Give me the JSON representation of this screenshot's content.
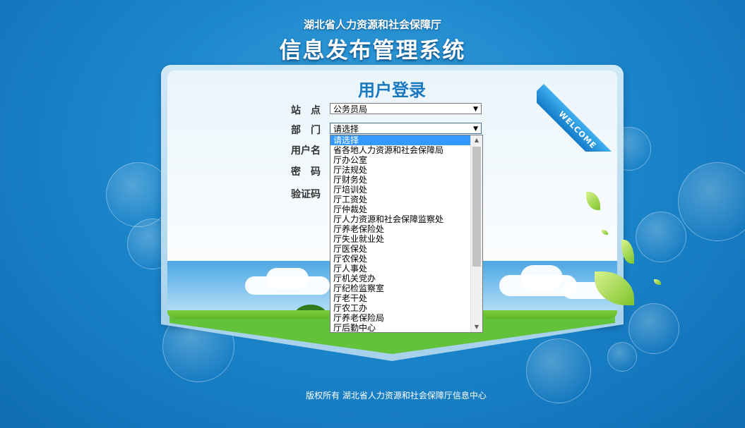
{
  "header": {
    "org_title": "湖北省人力资源和社会保障厅",
    "system_title": "信息发布管理系统"
  },
  "login": {
    "title": "用户登录",
    "ribbon_text": "WELCOME",
    "site_label": "站　点",
    "site_value": "公务员局",
    "dept_label": "部　门",
    "dept_value": "请选择",
    "username_label": "用户名",
    "password_label": "密　码",
    "captcha_label": "验证码",
    "dept_options": [
      "请选择",
      "省各地人力资源和社会保障局",
      "厅办公室",
      "厅法规处",
      "厅财务处",
      "厅培训处",
      "厅工资处",
      "厅仲裁处",
      "厅人力资源和社会保障监察处",
      "厅养老保险处",
      "厅失业就业处",
      "厅医保处",
      "厅农保处",
      "厅人事处",
      "厅机关党办",
      "厅纪检监察室",
      "厅老干处",
      "厅农工办",
      "厅养老保险局",
      "厅后勤中心"
    ],
    "selected_option_index": 0
  },
  "footer": {
    "copyright": "版权所有  湖北省人力资源和社会保障厅信息中心"
  },
  "colors": {
    "background": "#1c87cc",
    "title_blue": "#1a78c0",
    "selection": "#3399ff"
  }
}
